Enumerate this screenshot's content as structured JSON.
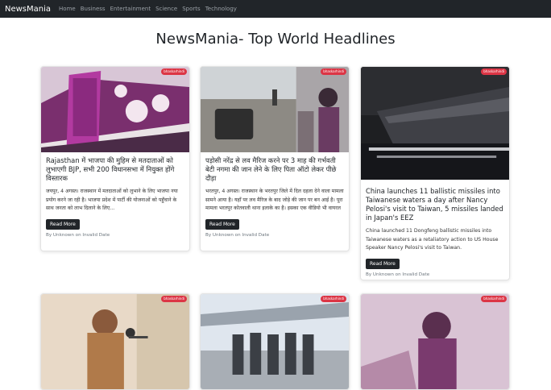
{
  "navbar": {
    "brand": "NewsMania",
    "links": [
      "Home",
      "Business",
      "Entertainment",
      "Science",
      "Sports",
      "Technology"
    ]
  },
  "page": {
    "title": "NewsMania- Top World Headlines"
  },
  "cards": [
    {
      "badge": "bhaskarhindi",
      "title": "Rajasthan में भाजपा की मुहिम से मतदाताओं को लुभाएगी BJP, सभी 200 विधानसभा में नियुक्त होंगे विस्तारक",
      "text": "जयपुर, 4 अगस्त। राजस्थान में मतदाताओं को लुभाने के लिए भाजपा नया प्रयोग करने जा रही है। भाजपा प्रदेश में पार्टी की योजनाओं को पहुँचाने के साथ जनता को लाभ दिलाने के लिए...",
      "button": "Read More",
      "meta": "By Unknown on Invalid Date"
    },
    {
      "badge": "bhaskarhindi",
      "title": "पड़ोसी नरेंद्र से लव मैरिज करने पर 3 माह की गर्भवती बेटी नगमा की जान लेने के लिए पिता ऑटो लेकर पीछे दौड़ा",
      "text": "भरतपुर, 4 अगस्त। राजस्थान के भरतपुर जिले में दिल दहला देने वाला मामला सामने आया है। यहाँ पर लव मैरिज के बाद जोड़े की जान पर बन आई है। पूरा मामला भरतपुर कोतवाली थाना इलाके का है। इसका एक वीडियो भी वायरल",
      "button": "Read More",
      "meta": "By Unknown on Invalid Date"
    },
    {
      "badge": "bhaskarhindi",
      "title": "China launches 11 ballistic missiles into Taiwanese waters a day after Nancy Pelosi's visit to Taiwan, 5 missiles landed in Japan's EEZ",
      "text": "China launched 11 Dongfeng ballistic missiles into Taiwanese waters as a retaliatory action to US House Speaker Nancy Pelosi's visit to Taiwan.",
      "button": "Read More",
      "meta": "By Unknown on Invalid Date"
    },
    {
      "badge": "bhaskarhindi"
    },
    {
      "badge": "bhaskarhindi"
    },
    {
      "badge": "bhaskarhindi"
    }
  ]
}
